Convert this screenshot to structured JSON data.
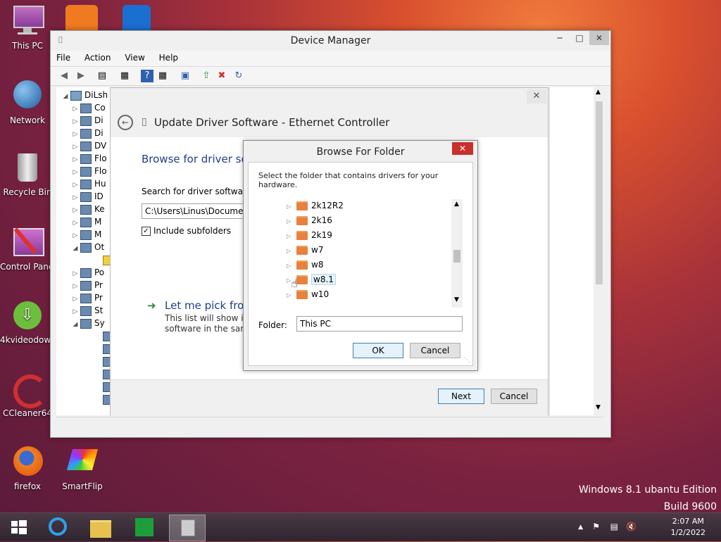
{
  "desktop": {
    "icons": [
      {
        "label": "This PC"
      },
      {
        "label": "Network"
      },
      {
        "label": "Recycle Bin"
      },
      {
        "label": "Control Panel"
      },
      {
        "label": "4kvideodow..."
      },
      {
        "label": "CCleaner64"
      },
      {
        "label": "firefox"
      },
      {
        "label": "SmartFlip"
      }
    ],
    "watermark_line1": "Windows 8.1 ubantu Edition",
    "watermark_line2": "Build 9600"
  },
  "device_manager": {
    "title": "Device Manager",
    "menu": [
      "File",
      "Action",
      "View",
      "Help"
    ],
    "tree_root": "DiLsh",
    "tree_items": [
      "Co",
      "Di",
      "Di",
      "DV",
      "Flo",
      "Flo",
      "Hu",
      "ID",
      "Ke",
      "M",
      "M",
      "Ot",
      "",
      "Po",
      "Pr",
      "Pr",
      "St",
      "Sy"
    ]
  },
  "wizard": {
    "title": "Update Driver Software - Ethernet Controller",
    "heading": "Browse for driver sof",
    "search_label": "Search for driver software in",
    "path_value": "C:\\Users\\Linus\\Document",
    "include_subfolders": "Include subfolders",
    "pick_heading": "Let me pick from",
    "pick_desc_line1": "This list will show inst",
    "pick_desc_line2": "software in the same",
    "next_label": "Next",
    "cancel_label": "Cancel"
  },
  "browse_folder": {
    "title": "Browse For Folder",
    "instruction": "Select the folder that contains drivers for your hardware.",
    "folders": [
      "2k12R2",
      "2k16",
      "2k19",
      "w7",
      "w8",
      "w8.1",
      "w10"
    ],
    "selected": "w8.1",
    "folder_label": "Folder:",
    "folder_value": "This PC",
    "ok_label": "OK",
    "cancel_label": "Cancel"
  },
  "taskbar": {
    "time": "2:07 AM",
    "date": "1/2/2022"
  }
}
